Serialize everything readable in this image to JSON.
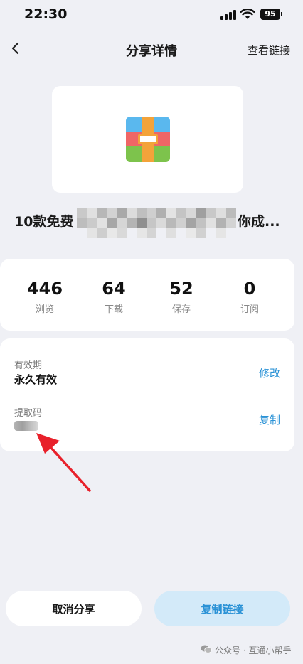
{
  "status_bar": {
    "time": "22:30",
    "battery": "95"
  },
  "nav": {
    "title": "分享详情",
    "right_action": "查看链接"
  },
  "file": {
    "name_prefix": "10款免费",
    "name_suffix": "你成...",
    "icon": "archive-icon"
  },
  "stats": [
    {
      "value": "446",
      "label": "浏览"
    },
    {
      "value": "64",
      "label": "下载"
    },
    {
      "value": "52",
      "label": "保存"
    },
    {
      "value": "0",
      "label": "订阅"
    }
  ],
  "details": {
    "validity_label": "有效期",
    "validity_value": "永久有效",
    "validity_action": "修改",
    "code_label": "提取码",
    "code_action": "复制"
  },
  "buttons": {
    "cancel": "取消分享",
    "copy_link": "复制链接"
  },
  "watermark": {
    "text": "公众号 · 互通小帮手"
  },
  "colors": {
    "accent": "#2a92d6",
    "copy_button_bg": "#d3eaf9",
    "page_bg": "#eff0f5",
    "arrow": "#e8212b"
  }
}
